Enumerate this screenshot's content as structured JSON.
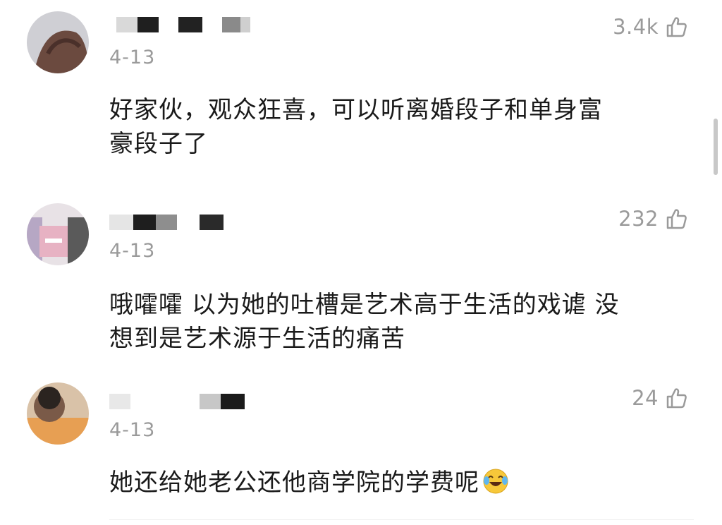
{
  "comments": [
    {
      "date": "4-13",
      "likes": "3.4k",
      "text_line1": "好家伙，观众狂喜，可以听离婚段子和单身富",
      "text_line2": "豪段子了"
    },
    {
      "date": "4-13",
      "likes": "232",
      "text_line1": "哦嚯嚯 以为她的吐槽是艺术高于生活的戏谑 没",
      "text_line2": "想到是艺术源于生活的痛苦"
    },
    {
      "date": "4-13",
      "likes": "24",
      "text_line1": "她还给她老公还他商学院的学费呢"
    }
  ],
  "icons": {
    "like": "thumbs-up-outline-icon",
    "emoji": "laughing-crying-emoji-icon"
  },
  "colors": {
    "text": "#1a1a1a",
    "meta": "#9a9a9a",
    "redacted": "#222222"
  }
}
